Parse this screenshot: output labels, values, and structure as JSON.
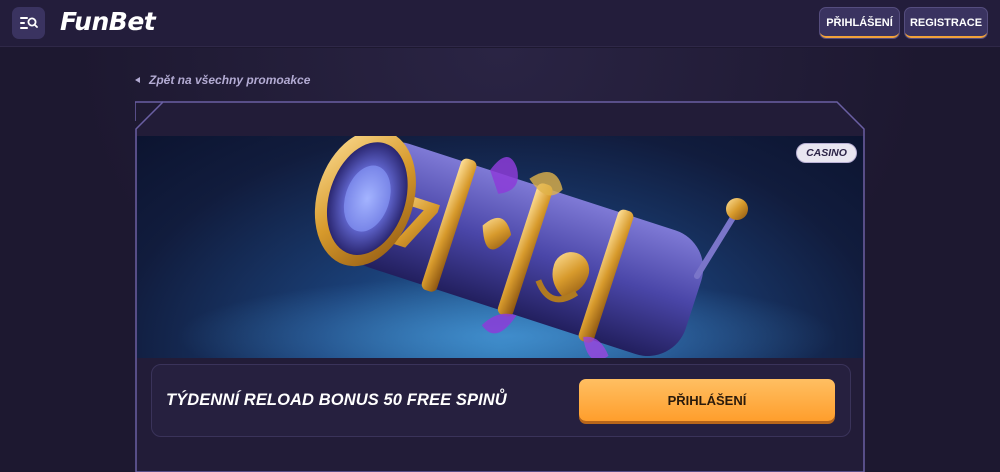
{
  "header": {
    "logo_text": "FunBet",
    "login_label": "PŘIHLÁŠENÍ",
    "register_label": "REGISTRACE",
    "menu_icon": "menu-search-icon"
  },
  "nav": {
    "back_label": "Zpět na všechny promoakce"
  },
  "promo": {
    "category_badge": "CASINO",
    "title": "TÝDENNÍ RELOAD BONUS 50 FREE SPINŮ",
    "cta_label": "PŘIHLÁŠENÍ",
    "banner_image": "slot-machine-reel-illustration"
  },
  "colors": {
    "background": "#1d1830",
    "header": "#231d3b",
    "accent": "#ff9e2c",
    "button": "#3a3360"
  }
}
